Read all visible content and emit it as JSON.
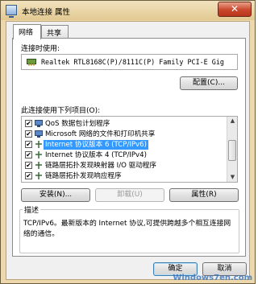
{
  "window": {
    "title": "本地连接 属性",
    "close_label": "✕"
  },
  "tabs": [
    {
      "label": "网络",
      "active": true
    },
    {
      "label": "共享",
      "active": false
    }
  ],
  "connect_using": {
    "label": "连接时使用:",
    "adapter": "Realtek RTL8168C(P)/8111C(P) Family PCI-E Gig",
    "configure_button": "配置(C)..."
  },
  "items_section": {
    "label": "此连接使用下列项目(O):",
    "items": [
      {
        "label": "QoS 数据包计划程序",
        "checked": true,
        "selected": false,
        "icon": "qos-icon"
      },
      {
        "label": "Microsoft 网络的文件和打印机共享",
        "checked": true,
        "selected": false,
        "icon": "file-share-icon"
      },
      {
        "label": "Internet 协议版本 6 (TCP/IPv6)",
        "checked": true,
        "selected": true,
        "icon": "protocol-icon"
      },
      {
        "label": "Internet 协议版本 4 (TCP/IPv4)",
        "checked": true,
        "selected": false,
        "icon": "protocol-icon"
      },
      {
        "label": "链路层拓扑发现映射器 I/O 驱动程序",
        "checked": true,
        "selected": false,
        "icon": "protocol-icon"
      },
      {
        "label": "链路层拓扑发现响应程序",
        "checked": true,
        "selected": false,
        "icon": "protocol-icon"
      }
    ]
  },
  "action_buttons": {
    "install": "安装(N)...",
    "uninstall": "卸载(U)",
    "properties": "属性(R)"
  },
  "description": {
    "legend": "描述",
    "text": "TCP/IPv6。最新版本的 Internet 协议,可提供跨越多个相互连接网络的通信。"
  },
  "footer": {
    "ok": "确定",
    "cancel": "取消"
  },
  "watermark": "Windows7en.com",
  "colors": {
    "selection": "#3399ff",
    "frame": "#ecd8ac",
    "close": "#c9472c"
  }
}
